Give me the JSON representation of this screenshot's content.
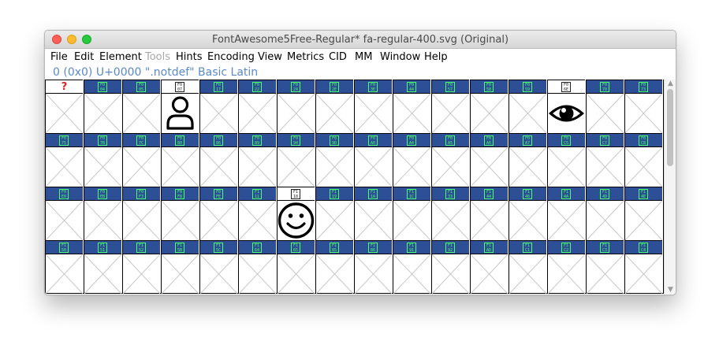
{
  "window": {
    "title": "FontAwesome5Free-Regular*  fa-regular-400.svg (Original)"
  },
  "menu": [
    {
      "label": "File",
      "enabled": true
    },
    {
      "label": "Edit",
      "enabled": true
    },
    {
      "label": "Element",
      "enabled": true
    },
    {
      "label": "Tools",
      "enabled": false
    },
    {
      "label": "Hints",
      "enabled": true
    },
    {
      "label": "Encoding",
      "enabled": true
    },
    {
      "label": "View",
      "enabled": true
    },
    {
      "label": "Metrics",
      "enabled": true
    },
    {
      "label": "CID",
      "enabled": true
    },
    {
      "label": "MM",
      "enabled": true
    },
    {
      "label": "Window",
      "enabled": true
    },
    {
      "label": "Help",
      "enabled": true
    }
  ],
  "info": {
    "text": "0 (0x0) U+0000 \".notdef\" Basic Latin"
  },
  "rows": [
    {
      "cells": [
        {
          "code": "?",
          "filled": false,
          "icon": "question-mark",
          "label_white": true
        },
        {
          "code": "F0 04",
          "filled": false
        },
        {
          "code": "F0 05",
          "filled": false
        },
        {
          "code": "F0 07",
          "filled": true,
          "icon": "user-icon",
          "label_white": true
        },
        {
          "code": "F0 17",
          "filled": false
        },
        {
          "code": "F0 22",
          "filled": false
        },
        {
          "code": "F0 24",
          "filled": false
        },
        {
          "code": "F0 2E",
          "filled": false
        },
        {
          "code": "F0 3E",
          "filled": false
        },
        {
          "code": "F0 44",
          "filled": false
        },
        {
          "code": "F0 57",
          "filled": false
        },
        {
          "code": "F0 58",
          "filled": false
        },
        {
          "code": "F0 59",
          "filled": false
        },
        {
          "code": "F0 6E",
          "filled": true,
          "icon": "eye-icon",
          "label_white": true
        },
        {
          "code": "F0 70",
          "filled": false
        },
        {
          "code": "F0 73",
          "filled": false
        }
      ]
    },
    {
      "cells": [
        {
          "code": "F0 75",
          "filled": false
        },
        {
          "code": "F0 7B",
          "filled": false
        },
        {
          "code": "F0 7C",
          "filled": false
        },
        {
          "code": "F0 80",
          "filled": false
        },
        {
          "code": "F0 86",
          "filled": false
        },
        {
          "code": "F0 89",
          "filled": false
        },
        {
          "code": "F0 94",
          "filled": false
        },
        {
          "code": "F0 9D",
          "filled": false
        },
        {
          "code": "F0 A0",
          "filled": false
        },
        {
          "code": "F0 A4",
          "filled": false
        },
        {
          "code": "F0 A5",
          "filled": false
        },
        {
          "code": "F0 A6",
          "filled": false
        },
        {
          "code": "F0 A7",
          "filled": false
        },
        {
          "code": "F0 C5",
          "filled": false
        },
        {
          "code": "F0 C7",
          "filled": false
        },
        {
          "code": "F0 C8",
          "filled": false
        }
      ]
    },
    {
      "cells": [
        {
          "code": "F0 E0",
          "filled": false
        },
        {
          "code": "F0 EB",
          "filled": false
        },
        {
          "code": "F0 F3",
          "filled": false
        },
        {
          "code": "F0 F8",
          "filled": false
        },
        {
          "code": "F0 FE",
          "filled": false
        },
        {
          "code": "F1 11",
          "filled": false
        },
        {
          "code": "F1 18",
          "filled": true,
          "icon": "smile-icon",
          "label_white": true
        },
        {
          "code": "F1 19",
          "filled": false
        },
        {
          "code": "F1 1A",
          "filled": false
        },
        {
          "code": "F1 1C",
          "filled": false
        },
        {
          "code": "F1 33",
          "filled": false
        },
        {
          "code": "F1 44",
          "filled": false
        },
        {
          "code": "F1 46",
          "filled": false
        },
        {
          "code": "F1 4A",
          "filled": false
        },
        {
          "code": "F1 4D",
          "filled": false
        },
        {
          "code": "F1 4E",
          "filled": false
        }
      ]
    },
    {
      "cells": [
        {
          "code": "F1 50",
          "filled": false
        },
        {
          "code": "F1 51",
          "filled": false
        },
        {
          "code": "F1 52",
          "filled": false
        },
        {
          "code": "F1 5B",
          "filled": false
        },
        {
          "code": "F1 5C",
          "filled": false
        },
        {
          "code": "F1 64",
          "filled": false
        },
        {
          "code": "F1 65",
          "filled": false
        },
        {
          "code": "F1 85",
          "filled": false
        },
        {
          "code": "F1 86",
          "filled": false
        },
        {
          "code": "F1 91",
          "filled": false
        },
        {
          "code": "F1 92",
          "filled": false
        },
        {
          "code": "F1 AD",
          "filled": false
        },
        {
          "code": "F1 C1",
          "filled": false
        },
        {
          "code": "F1 C2",
          "filled": false
        },
        {
          "code": "F1 C3",
          "filled": false
        },
        {
          "code": "F1 C4",
          "filled": false
        }
      ]
    }
  ],
  "colors": {
    "label_bar": "#2c4f96",
    "code_box": "#48ff6a",
    "info_text": "#5b8ac9",
    "notdef_mark": "#d9252c"
  }
}
